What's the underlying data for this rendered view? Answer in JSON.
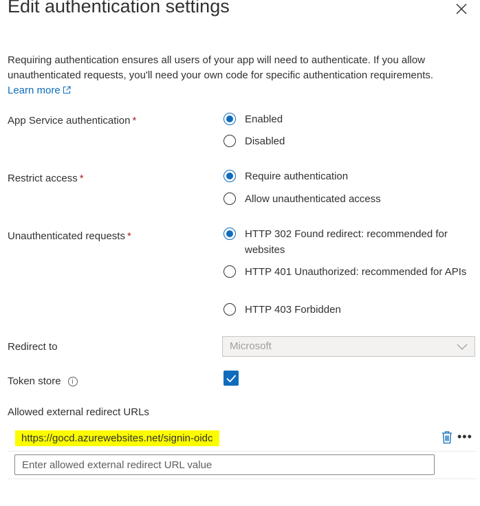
{
  "header": {
    "title": "Edit authentication settings",
    "close_icon": "close-icon"
  },
  "description": {
    "text": "Requiring authentication ensures all users of your app will need to authenticate. If you allow unauthenticated requests, you'll need your own code for specific authentication requirements.",
    "link": "Learn more"
  },
  "app_service_auth": {
    "label": "App Service authentication",
    "required": "*",
    "options": [
      "Enabled",
      "Disabled"
    ],
    "selected": "Enabled"
  },
  "restrict_access": {
    "label": "Restrict access",
    "required": "*",
    "options": [
      "Require authentication",
      "Allow unauthenticated access"
    ],
    "selected": "Require authentication"
  },
  "unauth_requests": {
    "label": "Unauthenticated requests",
    "required": "*",
    "options": [
      "HTTP 302 Found redirect: recommended for websites",
      "HTTP 401 Unauthorized: recommended for APIs",
      "HTTP 403 Forbidden"
    ],
    "selected": "HTTP 302 Found redirect: recommended for websites"
  },
  "redirect_to": {
    "label": "Redirect to",
    "value": "Microsoft"
  },
  "token_store": {
    "label": "Token store",
    "checked": true,
    "info_icon": "info-icon"
  },
  "allowed_urls": {
    "label": "Allowed external redirect URLs",
    "items": [
      "https://gocd.azurewebsites.net/signin-oidc"
    ],
    "placeholder": "Enter allowed external redirect URL value"
  },
  "colors": {
    "accent": "#0f6cbd",
    "required": "#a4262c",
    "highlight": "#fcfc00"
  }
}
